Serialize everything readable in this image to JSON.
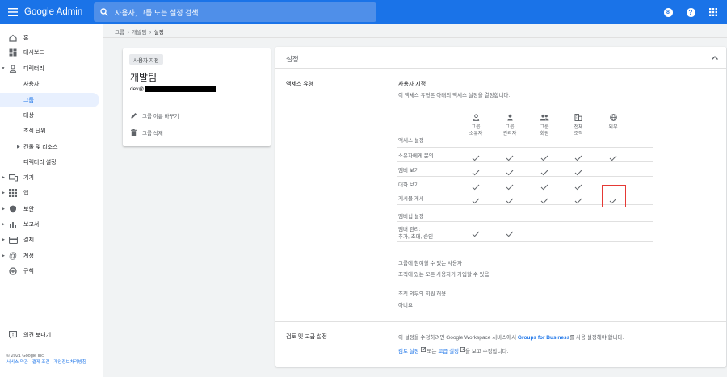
{
  "header": {
    "app_title": "Google Admin",
    "search_placeholder": "사용자, 그룹 또는 설정 검색",
    "notification_count": "8",
    "help_glyph": "?"
  },
  "sidebar": {
    "items": [
      {
        "label": "홈",
        "icon": "home-icon"
      },
      {
        "label": "대시보드",
        "icon": "dashboard-icon"
      },
      {
        "label": "디렉터리",
        "icon": "person-icon"
      },
      {
        "label": "사용자"
      },
      {
        "label": "그룹"
      },
      {
        "label": "대상"
      },
      {
        "label": "조직 단위"
      },
      {
        "label": "건물 및 리소스"
      },
      {
        "label": "디렉터리 설정"
      },
      {
        "label": "기기",
        "icon": "devices-icon"
      },
      {
        "label": "앱",
        "icon": "apps-icon"
      },
      {
        "label": "보안",
        "icon": "shield-icon"
      },
      {
        "label": "보고서",
        "icon": "bar-chart-icon"
      },
      {
        "label": "결제",
        "icon": "credit-card-icon"
      },
      {
        "label": "계정",
        "icon": "at-icon"
      },
      {
        "label": "규칙",
        "icon": "rules-icon"
      }
    ],
    "feedback": "의견 보내기",
    "copyright": "© 2021 Google Inc.",
    "footer_links": "서비스 약관 - 결제 조건 - 개인정보처리방침"
  },
  "breadcrumb": {
    "items": [
      "그룹",
      "개발팀",
      "설정"
    ]
  },
  "group_card": {
    "chip": "사용자 지정",
    "name": "개발팀",
    "email_prefix": "dev@",
    "rename": "그룹 이름 바꾸기",
    "delete": "그룹 삭제"
  },
  "settings": {
    "title": "설정",
    "access_type_label": "액세스 유형",
    "access_type_value": "사용자 지정",
    "access_type_desc": "이 액세스 유형은 아래의 액세스 설정을 결정합니다.",
    "access_settings_label": "액세스 설정",
    "columns": [
      {
        "line1": "그룹",
        "line2": "소유자",
        "icon": "person-icon"
      },
      {
        "line1": "그룹",
        "line2": "관리자",
        "icon": "person-icon"
      },
      {
        "line1": "그룹",
        "line2": "회원",
        "icon": "people-icon"
      },
      {
        "line1": "전체",
        "line2": "조직",
        "icon": "domain-icon"
      },
      {
        "line1": "외부",
        "line2": "",
        "icon": "globe-icon"
      }
    ],
    "rows": [
      {
        "label": "소유자에게 문의",
        "checks": [
          true,
          true,
          true,
          true,
          true
        ]
      },
      {
        "label": "멤버 보기",
        "checks": [
          true,
          true,
          true,
          true,
          false
        ]
      },
      {
        "label": "대화 보기",
        "checks": [
          true,
          true,
          true,
          true,
          false
        ]
      },
      {
        "label": "게시물 게시",
        "checks": [
          true,
          true,
          true,
          true,
          true
        ]
      }
    ],
    "membership_label": "멤버십 설정",
    "member_mgmt_line1": "멤버 관리:",
    "member_mgmt_line2": "추가, 초대, 승인",
    "member_mgmt_checks": [
      true,
      true,
      false,
      false,
      false
    ],
    "who_can_join_label": "그룹에 참여할 수 있는 사용자",
    "who_can_join_value": "조직에 있는 모든 사용자가 가입할 수 있음",
    "external_members_label": "조직 외부의 회원 허용",
    "external_members_value": "아니요",
    "review_label": "검토 및 고급 설정",
    "review_desc_prefix": "이 설정을 수정하려면 Google Workspace 서비스에서 ",
    "review_desc_link": "Groups for Business",
    "review_desc_suffix": "를 사용 설정해야 합니다.",
    "review_link1": "검토 설정",
    "review_mid": " 또는 ",
    "review_link2": "고급 설정",
    "review_end": "을 보고 수정합니다."
  }
}
